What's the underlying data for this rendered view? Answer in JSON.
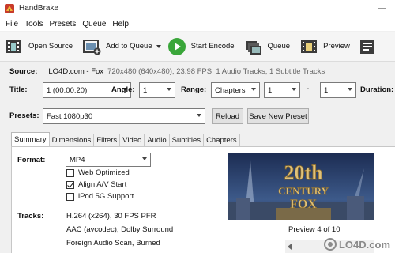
{
  "window": {
    "title": "HandBrake"
  },
  "menu": [
    "File",
    "Tools",
    "Presets",
    "Queue",
    "Help"
  ],
  "toolbar": {
    "open_source": "Open Source",
    "add_to_queue": "Add to Queue",
    "start_encode": "Start Encode",
    "queue": "Queue",
    "preview": "Preview"
  },
  "source": {
    "label": "Source:",
    "name": "LO4D.com - Fox",
    "details": "720x480 (640x480), 23.98 FPS, 1 Audio Tracks, 1 Subtitle Tracks"
  },
  "title_row": {
    "title_label": "Title:",
    "title_value": "1 (00:00:20)",
    "angle_label": "Angle:",
    "angle_value": "1",
    "range_label": "Range:",
    "range_value": "Chapters",
    "range_start": "1",
    "range_sep": "-",
    "range_end": "1",
    "duration_label": "Duration:"
  },
  "presets": {
    "label": "Presets:",
    "value": "Fast 1080p30",
    "reload": "Reload",
    "save_new": "Save New Preset"
  },
  "tabs": [
    "Summary",
    "Dimensions",
    "Filters",
    "Video",
    "Audio",
    "Subtitles",
    "Chapters"
  ],
  "summary": {
    "format_label": "Format:",
    "format_value": "MP4",
    "options": [
      {
        "label": "Web Optimized",
        "checked": false
      },
      {
        "label": "Align A/V Start",
        "checked": true
      },
      {
        "label": "iPod 5G Support",
        "checked": false
      }
    ],
    "tracks_label": "Tracks:",
    "tracks": [
      "H.264 (x264), 30 FPS PFR",
      "AAC (avcodec), Dolby Surround",
      "Foreign Audio Scan, Burned"
    ],
    "preview_caption": "Preview 4 of 10",
    "preview_image_text": [
      "20th",
      "CENTURY",
      "FOX"
    ]
  },
  "watermark": "LO4D.com",
  "colors": {
    "encode_green": "#3aa63a",
    "preview_sky": "#2a3f6b"
  }
}
